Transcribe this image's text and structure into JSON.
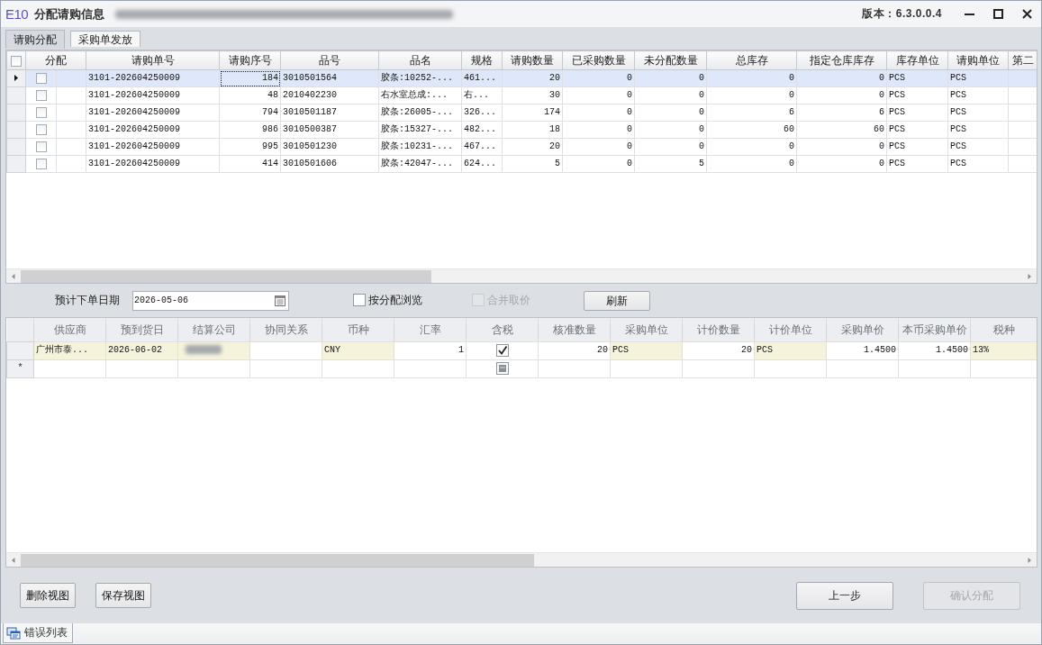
{
  "window": {
    "logo": "E10",
    "title": "分配请购信息",
    "title_suffix_blurred": true,
    "version": "版本：6.3.0.0.4"
  },
  "tabs": [
    {
      "label": "请购分配",
      "selected": true
    },
    {
      "label": "采购单发放",
      "selected": false
    }
  ],
  "request_grid": {
    "select_all_checked": false,
    "columns": [
      {
        "label": "分配",
        "kind": "check"
      },
      {
        "label": "请购单号",
        "kind": "text"
      },
      {
        "label": "请购序号",
        "kind": "number"
      },
      {
        "label": "品号",
        "kind": "text"
      },
      {
        "label": "品名",
        "kind": "text"
      },
      {
        "label": "规格",
        "kind": "text"
      },
      {
        "label": "请购数量",
        "kind": "number"
      },
      {
        "label": "已采购数量",
        "kind": "number"
      },
      {
        "label": "未分配数量",
        "kind": "number"
      },
      {
        "label": "总库存",
        "kind": "number"
      },
      {
        "label": "指定仓库库存",
        "kind": "number"
      },
      {
        "label": "库存单位",
        "kind": "text"
      },
      {
        "label": "请购单位",
        "kind": "text"
      },
      {
        "label": "第二",
        "kind": "text"
      }
    ],
    "rows": [
      {
        "selected": true,
        "cells": [
          {
            "checked": false
          },
          "3101-202604250009",
          "184",
          "3010501564",
          "胶条:10252-...",
          "461...",
          "20",
          "0",
          "0",
          "0",
          "0",
          "PCS",
          "PCS"
        ]
      },
      {
        "selected": false,
        "cells": [
          {
            "checked": false
          },
          "3101-202604250009",
          "48",
          "2010402230",
          "右水室总成:...",
          "右...",
          "30",
          "0",
          "0",
          "0",
          "0",
          "PCS",
          "PCS"
        ]
      },
      {
        "selected": false,
        "cells": [
          {
            "checked": false
          },
          "3101-202604250009",
          "794",
          "3010501187",
          "胶条:26005-...",
          "326...",
          "174",
          "0",
          "0",
          "6",
          "6",
          "PCS",
          "PCS"
        ]
      },
      {
        "selected": false,
        "cells": [
          {
            "checked": false
          },
          "3101-202604250009",
          "986",
          "3010500387",
          "胶条:15327-...",
          "482...",
          "18",
          "0",
          "0",
          "60",
          "60",
          "PCS",
          "PCS"
        ]
      },
      {
        "selected": false,
        "cells": [
          {
            "checked": false
          },
          "3101-202604250009",
          "995",
          "3010501230",
          "胶条:10231-...",
          "467...",
          "20",
          "0",
          "0",
          "0",
          "0",
          "PCS",
          "PCS"
        ]
      },
      {
        "selected": false,
        "cells": [
          {
            "checked": false
          },
          "3101-202604250009",
          "414",
          "3010501606",
          "胶条:42047-...",
          "624...",
          "5",
          "0",
          "5",
          "0",
          "0",
          "PCS",
          "PCS"
        ]
      }
    ]
  },
  "order_form": {
    "date_label": "预计下单日期",
    "date_value": "2026-05-06",
    "options": [
      {
        "label": "按分配浏览",
        "checked": false,
        "disabled": false
      },
      {
        "label": "合并取价",
        "checked": false,
        "disabled": true
      }
    ],
    "refresh_button": "刷新"
  },
  "purchase_grid": {
    "columns": [
      {
        "label": "供应商",
        "kind": "text",
        "editable": true
      },
      {
        "label": "预到货日",
        "kind": "text",
        "editable": true
      },
      {
        "label": "结算公司",
        "kind": "text",
        "editable": true
      },
      {
        "label": "协同关系",
        "kind": "text",
        "editable": false
      },
      {
        "label": "币种",
        "kind": "text",
        "editable": true
      },
      {
        "label": "汇率",
        "kind": "number",
        "editable": false
      },
      {
        "label": "含税",
        "kind": "check",
        "editable": false
      },
      {
        "label": "核准数量",
        "kind": "number",
        "editable": false
      },
      {
        "label": "采购单位",
        "kind": "text",
        "editable": true
      },
      {
        "label": "计价数量",
        "kind": "number",
        "editable": false
      },
      {
        "label": "计价单位",
        "kind": "text",
        "editable": true
      },
      {
        "label": "采购单价",
        "kind": "number",
        "editable": false
      },
      {
        "label": "本币采购单价",
        "kind": "number",
        "editable": false
      },
      {
        "label": "税种",
        "kind": "text",
        "editable": true
      }
    ],
    "rows": [
      {
        "new_row": false,
        "cells": [
          {
            "kind": "text",
            "value": "广州市泰..."
          },
          {
            "kind": "text",
            "value": "2026-06-02"
          },
          {
            "kind": "blurred"
          },
          {
            "kind": "blank"
          },
          {
            "kind": "text",
            "value": "CNY"
          },
          {
            "kind": "text",
            "value": "1"
          },
          {
            "kind": "check",
            "checked": true,
            "indeterminate": false
          },
          {
            "kind": "text",
            "value": "20"
          },
          {
            "kind": "text",
            "value": "PCS"
          },
          {
            "kind": "text",
            "value": "20"
          },
          {
            "kind": "text",
            "value": "PCS"
          },
          {
            "kind": "text",
            "value": "1.4500"
          },
          {
            "kind": "text",
            "value": "1.4500"
          },
          {
            "kind": "text",
            "value": "13%"
          }
        ]
      },
      {
        "new_row": true,
        "marker": "*",
        "cells": [
          {
            "kind": "blank"
          },
          {
            "kind": "blank"
          },
          {
            "kind": "blank"
          },
          {
            "kind": "blank"
          },
          {
            "kind": "blank"
          },
          {
            "kind": "blank"
          },
          {
            "kind": "check",
            "checked": false,
            "indeterminate": true
          },
          {
            "kind": "blank"
          },
          {
            "kind": "blank"
          },
          {
            "kind": "blank"
          },
          {
            "kind": "blank"
          },
          {
            "kind": "blank"
          },
          {
            "kind": "blank"
          },
          {
            "kind": "blank"
          }
        ]
      }
    ]
  },
  "view_buttons": [
    {
      "label": "删除视图"
    },
    {
      "label": "保存视图"
    }
  ],
  "nav_buttons": [
    {
      "label": "上一步",
      "disabled": false
    },
    {
      "label": "确认分配",
      "disabled": true
    }
  ],
  "bottom_tabs": [
    {
      "label": "错误列表"
    }
  ]
}
